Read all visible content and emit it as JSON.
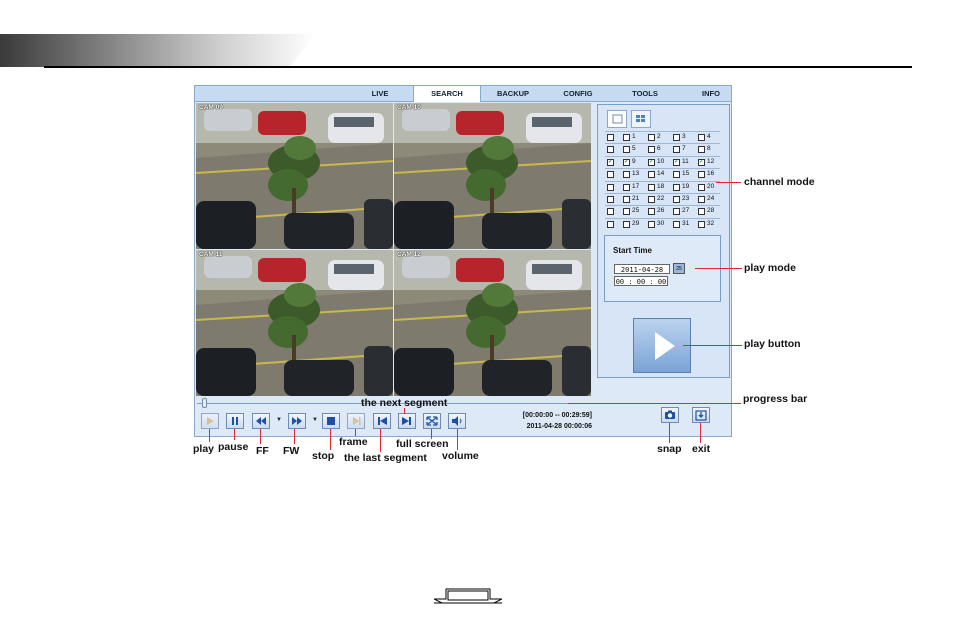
{
  "tabs": [
    {
      "label": "LIVE"
    },
    {
      "label": "SEARCH"
    },
    {
      "label": "BACKUP"
    },
    {
      "label": "CONFIG"
    },
    {
      "label": "TOOLS"
    },
    {
      "label": "INFO"
    }
  ],
  "active_tab": "SEARCH",
  "cameras": [
    {
      "label": "CAM 09"
    },
    {
      "label": "CAM 10"
    },
    {
      "label": "CAM 11"
    },
    {
      "label": "CAM 12"
    }
  ],
  "channel_grid": {
    "rows": [
      {
        "row_checked": false,
        "channels": [
          {
            "n": "1",
            "c": false
          },
          {
            "n": "2",
            "c": false
          },
          {
            "n": "3",
            "c": false
          },
          {
            "n": "4",
            "c": false
          }
        ]
      },
      {
        "row_checked": false,
        "channels": [
          {
            "n": "5",
            "c": false
          },
          {
            "n": "6",
            "c": false
          },
          {
            "n": "7",
            "c": false
          },
          {
            "n": "8",
            "c": false
          }
        ]
      },
      {
        "row_checked": true,
        "channels": [
          {
            "n": "9",
            "c": true
          },
          {
            "n": "10",
            "c": true
          },
          {
            "n": "11",
            "c": true
          },
          {
            "n": "12",
            "c": true
          }
        ]
      },
      {
        "row_checked": false,
        "channels": [
          {
            "n": "13",
            "c": false
          },
          {
            "n": "14",
            "c": false
          },
          {
            "n": "15",
            "c": false
          },
          {
            "n": "16",
            "c": false
          }
        ]
      },
      {
        "row_checked": false,
        "channels": [
          {
            "n": "17",
            "c": false
          },
          {
            "n": "18",
            "c": false
          },
          {
            "n": "19",
            "c": false
          },
          {
            "n": "20",
            "c": false
          }
        ]
      },
      {
        "row_checked": false,
        "channels": [
          {
            "n": "21",
            "c": false
          },
          {
            "n": "22",
            "c": false
          },
          {
            "n": "23",
            "c": false
          },
          {
            "n": "24",
            "c": false
          }
        ]
      },
      {
        "row_checked": false,
        "channels": [
          {
            "n": "25",
            "c": false
          },
          {
            "n": "26",
            "c": false
          },
          {
            "n": "27",
            "c": false
          },
          {
            "n": "28",
            "c": false
          }
        ]
      },
      {
        "row_checked": false,
        "channels": [
          {
            "n": "29",
            "c": false
          },
          {
            "n": "30",
            "c": false
          },
          {
            "n": "31",
            "c": false
          },
          {
            "n": "32",
            "c": false
          }
        ]
      }
    ]
  },
  "start_time": {
    "title": "Start Time",
    "date": "2011-04-28",
    "time": "00 : 00 : 00",
    "calendar_label": "25"
  },
  "playback": {
    "segment_range": "[00:00:00 -- 00:29:59]",
    "current_time": "2011-04-28 00:00:06",
    "progress": 0.01
  },
  "annotations": {
    "channel_mode": "channel mode",
    "play_mode": "play mode",
    "play_button": "play button",
    "progress_bar": "progress bar",
    "next_segment": "the next segment",
    "play": "play",
    "pause": "pause",
    "ff": "FF",
    "fw": "FW",
    "stop": "stop",
    "frame": "frame",
    "last_segment": "the last segment",
    "full_screen": "full screen",
    "volume": "volume",
    "snap": "snap",
    "exit": "exit"
  },
  "colors": {
    "annotation_line": "#e0282e",
    "panel_bg": "#d7e5f6",
    "tab_bar": "#c6daf2"
  }
}
